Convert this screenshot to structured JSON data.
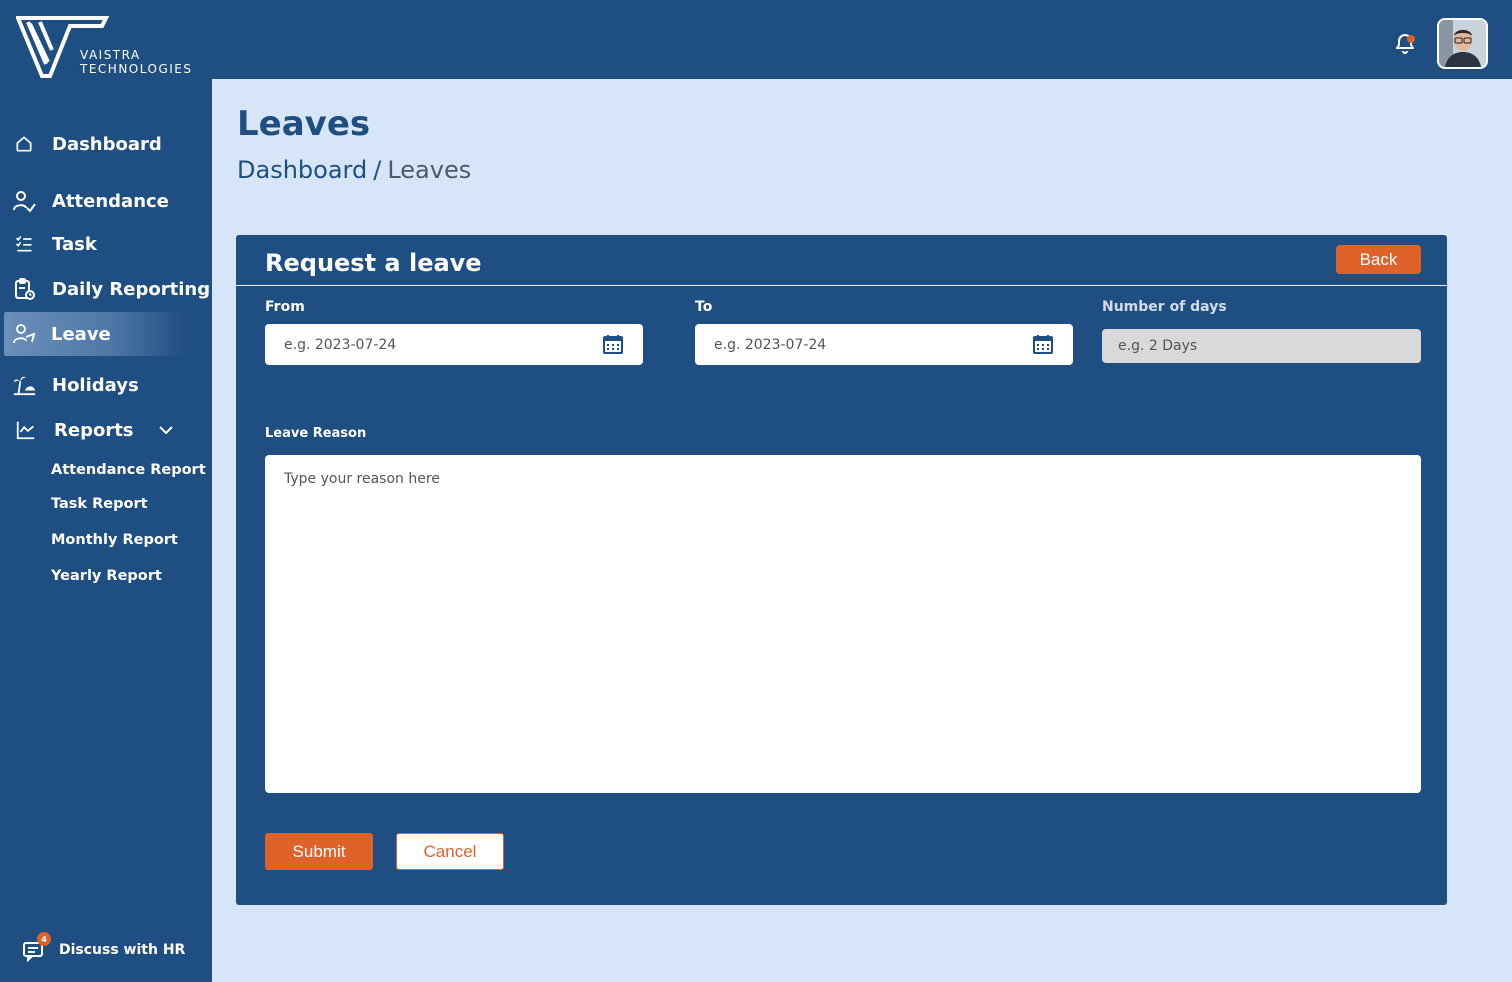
{
  "brand": {
    "line1": "VAISTRA",
    "line2": "TECHNOLOGIES"
  },
  "header": {
    "notification_icon": "bell-icon",
    "accent": "#e0622b",
    "primary": "#1f4e82"
  },
  "sidebar": {
    "items": [
      {
        "label": "Dashboard",
        "icon": "home-icon"
      },
      {
        "label": "Attendance",
        "icon": "user-check-icon"
      },
      {
        "label": "Task",
        "icon": "checklist-icon"
      },
      {
        "label": "Daily Reporting",
        "icon": "clipboard-clock-icon"
      },
      {
        "label": "Leave",
        "icon": "leave-icon",
        "active": true
      },
      {
        "label": "Holidays",
        "icon": "beach-icon"
      },
      {
        "label": "Reports",
        "icon": "line-chart-icon"
      }
    ],
    "reports_sub": [
      "Attendance  Report",
      "Task Report",
      "Monthly Report",
      "Yearly Report"
    ],
    "discuss": {
      "label": "Discuss with HR",
      "badge": "4"
    }
  },
  "main": {
    "title": "Leaves",
    "breadcrumb": {
      "root": "Dashboard",
      "sep": "/",
      "current": "Leaves"
    }
  },
  "form": {
    "title": "Request a leave",
    "back_label": "Back",
    "from": {
      "label": "From",
      "placeholder": "e.g. 2023-07-24"
    },
    "to": {
      "label": "To",
      "placeholder": "e.g. 2023-07-24"
    },
    "days": {
      "label": "Number of days",
      "placeholder": "e.g. 2 Days"
    },
    "reason": {
      "label": "Leave Reason",
      "placeholder": "Type your reason here"
    },
    "submit_label": "Submit",
    "cancel_label": "Cancel"
  }
}
